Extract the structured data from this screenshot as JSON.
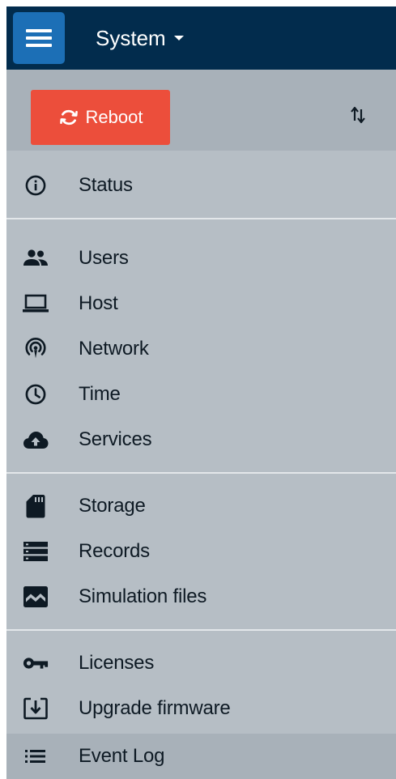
{
  "header": {
    "title": "System"
  },
  "toolbar": {
    "reboot_label": "Reboot"
  },
  "menu": {
    "items": [
      {
        "label": "Status",
        "icon": "info-icon"
      },
      {
        "label": "Users",
        "icon": "users-icon"
      },
      {
        "label": "Host",
        "icon": "laptop-icon"
      },
      {
        "label": "Network",
        "icon": "network-icon"
      },
      {
        "label": "Time",
        "icon": "clock-icon"
      },
      {
        "label": "Services",
        "icon": "cloud-upload-icon"
      },
      {
        "label": "Storage",
        "icon": "sd-card-icon"
      },
      {
        "label": "Records",
        "icon": "records-icon"
      },
      {
        "label": "Simulation files",
        "icon": "simulation-icon"
      },
      {
        "label": "Licenses",
        "icon": "key-icon"
      },
      {
        "label": "Upgrade firmware",
        "icon": "upgrade-icon"
      },
      {
        "label": "Event Log",
        "icon": "list-icon"
      }
    ],
    "active": "Event Log"
  },
  "colors": {
    "topbar": "#022c4d",
    "menu_button": "#1c6fb6",
    "reboot": "#ec4e3b",
    "panel": "#b6bec5",
    "active_row": "#a8b1b9"
  }
}
